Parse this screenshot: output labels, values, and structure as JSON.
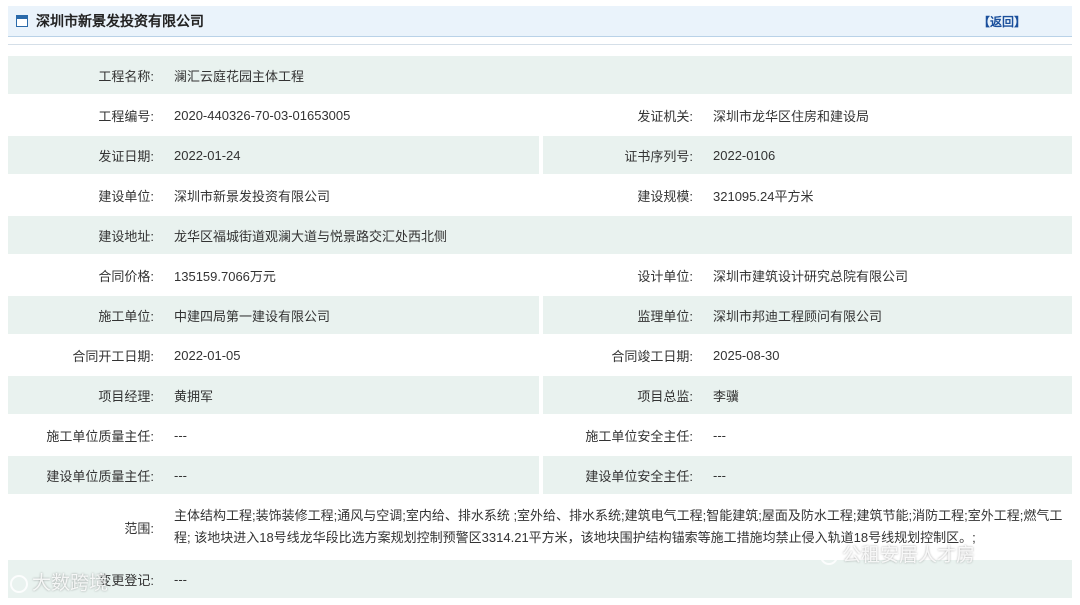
{
  "header": {
    "title": "深圳市新景发投资有限公司",
    "back_label": "【返回】"
  },
  "rows": [
    {
      "l1": "工程名称:",
      "v1": "澜汇云庭花园主体工程"
    },
    {
      "l1": "工程编号:",
      "v1": "2020-440326-70-03-01653005",
      "l2": "发证机关:",
      "v2": "深圳市龙华区住房和建设局"
    },
    {
      "l1": "发证日期:",
      "v1": "2022-01-24",
      "l2": "证书序列号:",
      "v2": "2022-0106"
    },
    {
      "l1": "建设单位:",
      "v1": "深圳市新景发投资有限公司",
      "l2": "建设规模:",
      "v2": "321095.24平方米"
    },
    {
      "l1": "建设地址:",
      "v1": "龙华区福城街道观澜大道与悦景路交汇处西北侧"
    },
    {
      "l1": "合同价格:",
      "v1": "135159.7066万元",
      "l2": "设计单位:",
      "v2": "深圳市建筑设计研究总院有限公司"
    },
    {
      "l1": "施工单位:",
      "v1": "中建四局第一建设有限公司",
      "l2": "监理单位:",
      "v2": "深圳市邦迪工程顾问有限公司"
    },
    {
      "l1": "合同开工日期:",
      "v1": "2022-01-05",
      "l2": "合同竣工日期:",
      "v2": "2025-08-30"
    },
    {
      "l1": "项目经理:",
      "v1": "黄拥军",
      "l2": "项目总监:",
      "v2": "李骥"
    },
    {
      "l1": "施工单位质量主任:",
      "v1": "---",
      "l2": "施工单位安全主任:",
      "v2": "---"
    },
    {
      "l1": "建设单位质量主任:",
      "v1": "---",
      "l2": "建设单位安全主任:",
      "v2": "---"
    },
    {
      "l1": "范围:",
      "v1": "主体结构工程;装饰装修工程;通风与空调;室内给、排水系统 ;室外给、排水系统;建筑电气工程;智能建筑;屋面及防水工程;建筑节能;消防工程;室外工程;燃气工程; 该地块进入18号线龙华段比选方案规划控制预警区3314.21平方米，该地块围护结构锚索等施工措施均禁止侵入轨道18号线规划控制区。;"
    },
    {
      "l1": "变更登记:",
      "v1": "---"
    }
  ],
  "watermarks": {
    "left": "大数跨境",
    "right": "公租安居人才房"
  }
}
